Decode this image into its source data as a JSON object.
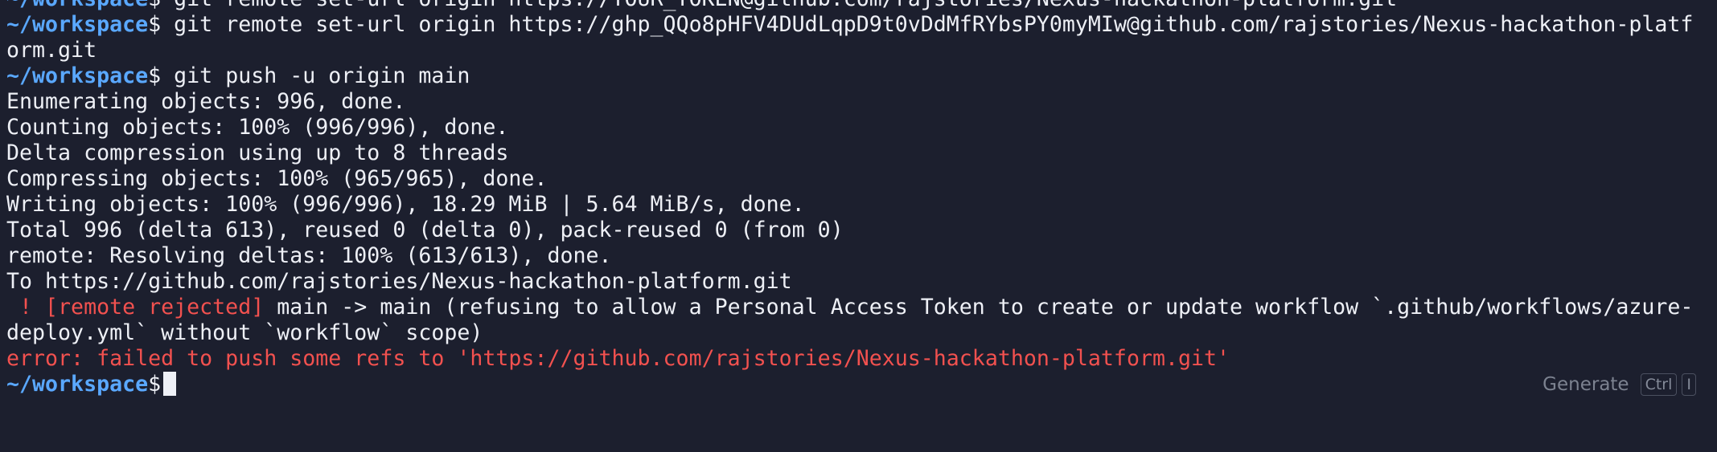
{
  "terminal": {
    "prompt": "~/workspace",
    "prompt_suffix": "$",
    "lines": {
      "l0_cmd": " git remote set-url origin https://YOUR_TOKEN@github.com/rajstories/Nexus-hackathon-platform.git",
      "l1_cmd": " git remote set-url origin https://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@github.com/rajstories/Nexus-hackathon-platf",
      "l2": "orm.git",
      "l3_cmd": " git push -u origin main",
      "l4": "Enumerating objects: 996, done.",
      "l5": "Counting objects: 100% (996/996), done.",
      "l6": "Delta compression using up to 8 threads",
      "l7": "Compressing objects: 100% (965/965), done.",
      "l8": "Writing objects: 100% (996/996), 18.29 MiB | 5.64 MiB/s, done.",
      "l9": "Total 996 (delta 613), reused 0 (delta 0), pack-reused 0 (from 0)",
      "l10": "remote: Resolving deltas: 100% (613/613), done.",
      "l11": "To https://github.com/rajstories/Nexus-hackathon-platform.git",
      "l12_bang": " ! [remote rejected]",
      "l12_rest": " main -> main (refusing to allow a Personal Access Token to create or update workflow `.github/workflows/azure-",
      "l13": "deploy.yml` without `workflow` scope)",
      "l14": "error: failed to push some refs to 'https://github.com/rajstories/Nexus-hackathon-platform.git'",
      "l15_cmd": " "
    }
  },
  "hint": {
    "label": "Generate",
    "key1": "Ctrl",
    "key2": "I"
  },
  "colors": {
    "background": "#1c1f2e",
    "prompt": "#5aa8ff",
    "error": "#f2514f",
    "text": "#eef0f6"
  }
}
